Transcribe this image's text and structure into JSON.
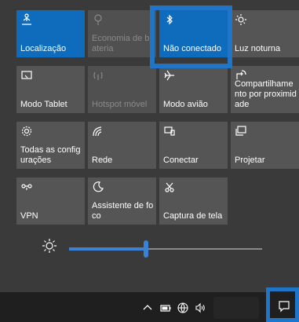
{
  "tiles": [
    {
      "label": "Localização",
      "icon": "location-icon",
      "state": "active"
    },
    {
      "label": "Economia de bateria",
      "icon": "battery-saver-icon",
      "state": "disabled"
    },
    {
      "label": "Não conectado",
      "icon": "bluetooth-icon",
      "state": "active"
    },
    {
      "label": "Luz noturna",
      "icon": "night-light-icon",
      "state": "normal"
    },
    {
      "label": "Modo Tablet",
      "icon": "tablet-mode-icon",
      "state": "normal"
    },
    {
      "label": "Hotspot móvel",
      "icon": "mobile-hotspot-icon",
      "state": "disabled"
    },
    {
      "label": "Modo avião",
      "icon": "airplane-icon",
      "state": "normal"
    },
    {
      "label": "Compartilhamento por proximidade",
      "icon": "nearby-sharing-icon",
      "state": "normal"
    },
    {
      "label": "Todas as configurações",
      "icon": "settings-gear-icon",
      "state": "normal"
    },
    {
      "label": "Rede",
      "icon": "network-icon",
      "state": "normal"
    },
    {
      "label": "Conectar",
      "icon": "connect-icon",
      "state": "normal"
    },
    {
      "label": "Projetar",
      "icon": "project-icon",
      "state": "normal"
    },
    {
      "label": "VPN",
      "icon": "vpn-icon",
      "state": "normal"
    },
    {
      "label": "Assistente de foco",
      "icon": "focus-assist-icon",
      "state": "normal"
    },
    {
      "label": "Captura de tela",
      "icon": "screen-snip-icon",
      "state": "normal"
    }
  ],
  "brightness": {
    "icon": "brightness-sun-icon",
    "level": 0.4
  },
  "taskbar": {
    "icons": [
      "chevron-up-icon",
      "battery-icon",
      "globe-network-icon",
      "volume-icon"
    ],
    "action_center_icon": "action-center-icon"
  },
  "colors": {
    "active_tile": "#0f6cbd",
    "highlight": "#1f75c8",
    "accent": "#3b82d6"
  }
}
